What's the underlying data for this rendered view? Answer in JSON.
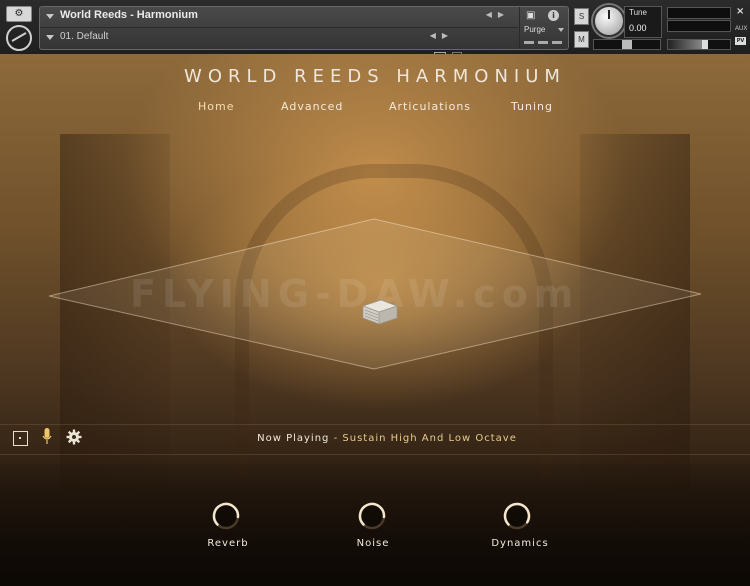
{
  "kontakt": {
    "instrument_name": "World Reeds - Harmonium",
    "preset_name": "01. Default",
    "purge_label": "Purge",
    "s_button": "S",
    "m_button": "M",
    "tune_label": "Tune",
    "tune_value": "0.00",
    "aux_label": "AUX",
    "pv_label": "PV"
  },
  "instrument": {
    "title": "WORLD REEDS HARMONIUM",
    "tabs": [
      {
        "label": "Home"
      },
      {
        "label": "Advanced"
      },
      {
        "label": "Articulations"
      },
      {
        "label": "Tuning"
      }
    ],
    "active_tab": "Home",
    "watermark": "FLYING-DAW.com",
    "status": {
      "now_playing_label": "Now Playing",
      "separator": "-",
      "now_playing_value": "Sustain High And Low Octave"
    },
    "effects": [
      {
        "label": "Reverb",
        "value": 0.85
      },
      {
        "label": "Noise",
        "value": 0.85
      },
      {
        "label": "Dynamics",
        "value": 0.95
      }
    ]
  },
  "colors": {
    "accent_gold": "#e8c98d",
    "text_light": "#f2eadc",
    "background_dark": "#1b130b"
  }
}
